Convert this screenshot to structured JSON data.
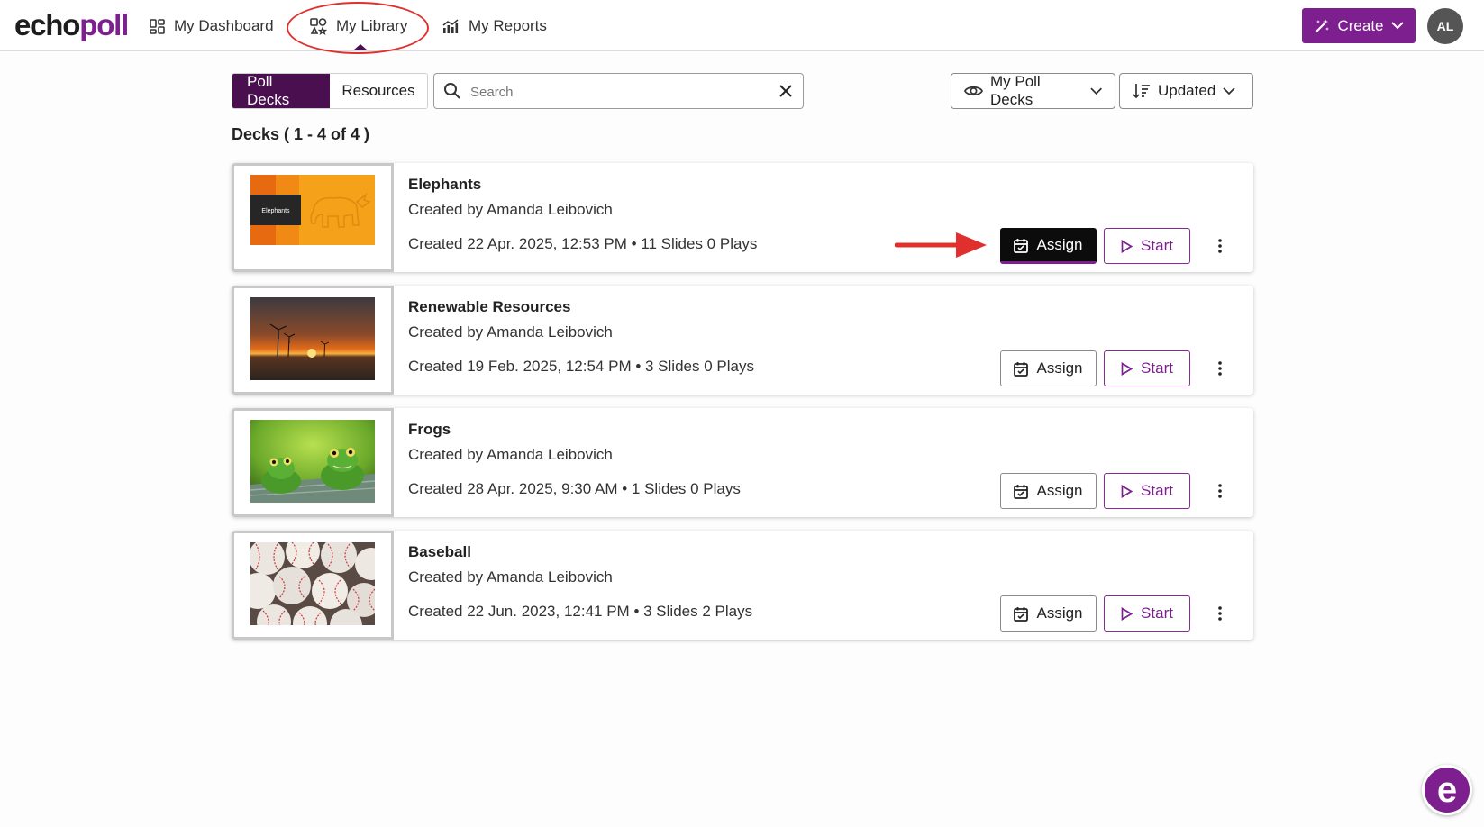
{
  "header": {
    "logo": {
      "part1": "echo",
      "part2": "poll"
    },
    "nav": [
      {
        "label": "My Dashboard",
        "icon": "dashboard-icon"
      },
      {
        "label": "My Library",
        "icon": "library-icon",
        "active": true
      },
      {
        "label": "My Reports",
        "icon": "reports-icon"
      }
    ],
    "create_label": "Create",
    "avatar_initials": "AL"
  },
  "toolbar": {
    "tabs": [
      {
        "label": "Poll Decks",
        "active": true
      },
      {
        "label": "Resources",
        "active": false
      }
    ],
    "search": {
      "placeholder": "Search",
      "value": ""
    },
    "filter_label": "My Poll Decks",
    "sort_label": "Updated"
  },
  "decks_count": "Decks ( 1 - 4 of 4 )",
  "decks": [
    {
      "title": "Elephants",
      "author": "Created by  Amanda Leibovich",
      "meta": "Created 22 Apr. 2025, 12:53 PM • 11 Slides 0 Plays",
      "thumb_label": "Elephants",
      "assign_label": "Assign",
      "start_label": "Start"
    },
    {
      "title": "Renewable Resources",
      "author": "Created by  Amanda Leibovich",
      "meta": "Created 19 Feb. 2025, 12:54 PM • 3 Slides 0 Plays",
      "assign_label": "Assign",
      "start_label": "Start"
    },
    {
      "title": "Frogs",
      "author": "Created by  Amanda Leibovich",
      "meta": "Created 28 Apr. 2025, 9:30 AM • 1 Slides 0 Plays",
      "assign_label": "Assign",
      "start_label": "Start"
    },
    {
      "title": "Baseball",
      "author": "Created by  Amanda Leibovich",
      "meta": "Created 22 Jun. 2023, 12:41 PM • 3 Slides 2 Plays",
      "assign_label": "Assign",
      "start_label": "Start"
    }
  ],
  "help_fab_label": "e",
  "colors": {
    "brand": "#7d1f8f",
    "active_tab": "#4a0f4f",
    "annotation": "#e0302e"
  }
}
